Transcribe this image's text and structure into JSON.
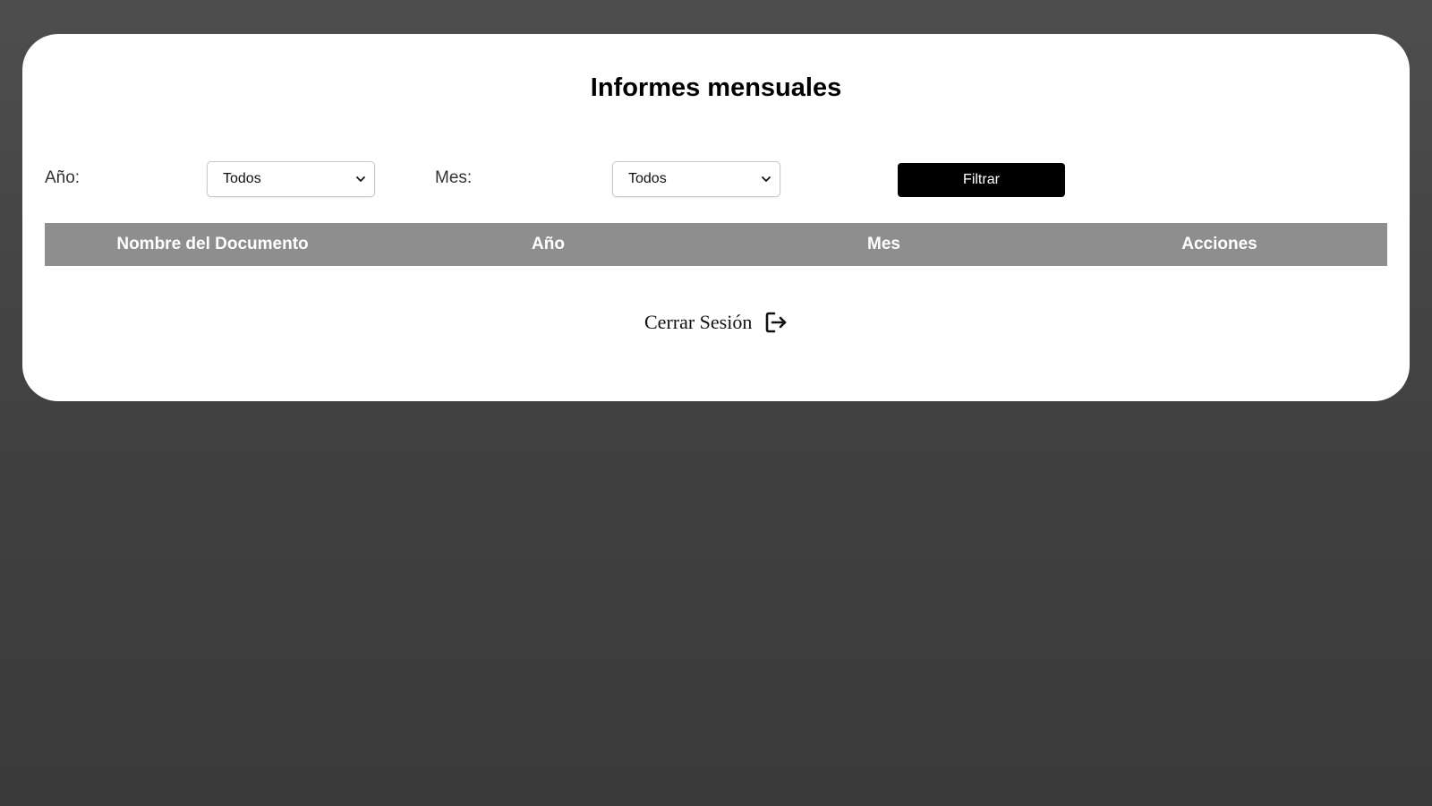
{
  "page": {
    "title": "Informes mensuales"
  },
  "filters": {
    "year_label": "Año:",
    "year_selected": "Todos",
    "month_label": "Mes:",
    "month_selected": "Todos",
    "filter_button": "Filtrar"
  },
  "table": {
    "columns": [
      "Nombre del Documento",
      "Año",
      "Mes",
      "Acciones"
    ],
    "rows": []
  },
  "logout": {
    "label": "Cerrar Sesión",
    "icon": "logout-icon"
  },
  "colors": {
    "background": "#444444",
    "card": "#ffffff",
    "header_bg": "#8e8e8e",
    "button_bg": "#000000"
  }
}
